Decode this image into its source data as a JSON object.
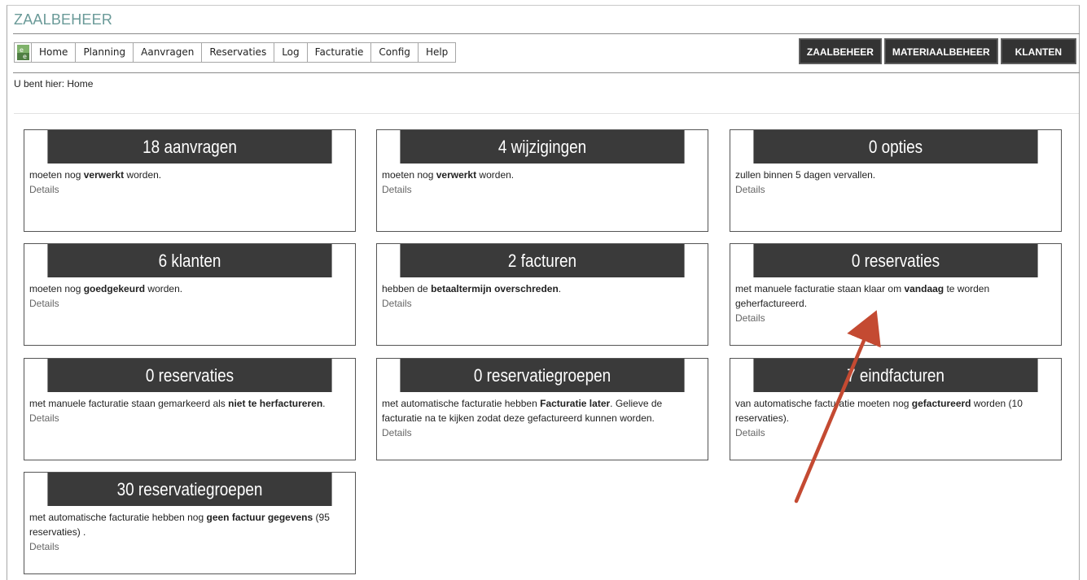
{
  "app": {
    "title": "ZAALBEHEER"
  },
  "menu": {
    "logo_icon": "app-logo-icon",
    "items": [
      "Home",
      "Planning",
      "Aanvragen",
      "Reservaties",
      "Log",
      "Facturatie",
      "Config",
      "Help"
    ]
  },
  "top_buttons": [
    "ZAALBEHEER",
    "MATERIAALBEHEER",
    "KLANTEN"
  ],
  "breadcrumb": "U bent hier: Home",
  "cards": [
    {
      "title": "18 aanvragen",
      "body": [
        {
          "t": "moeten nog "
        },
        {
          "b": "verwerkt"
        },
        {
          "t": " worden."
        }
      ],
      "details": "Details"
    },
    {
      "title": "4 wijzigingen",
      "body": [
        {
          "t": "moeten nog "
        },
        {
          "b": "verwerkt"
        },
        {
          "t": " worden."
        }
      ],
      "details": "Details"
    },
    {
      "title": "0 opties",
      "body": [
        {
          "t": "zullen binnen 5 dagen vervallen."
        }
      ],
      "details": "Details"
    },
    {
      "title": "6 klanten",
      "body": [
        {
          "t": "moeten nog "
        },
        {
          "b": "goedgekeurd"
        },
        {
          "t": " worden."
        }
      ],
      "details": "Details"
    },
    {
      "title": "2 facturen",
      "body": [
        {
          "t": "hebben de "
        },
        {
          "b": "betaaltermijn overschreden"
        },
        {
          "t": "."
        }
      ],
      "details": "Details"
    },
    {
      "title": "0 reservaties",
      "body": [
        {
          "t": "met manuele facturatie staan klaar om "
        },
        {
          "b": "vandaag"
        },
        {
          "t": " te worden geherfactureerd."
        }
      ],
      "details": "Details"
    },
    {
      "title": "0 reservaties",
      "body": [
        {
          "t": "met manuele facturatie staan gemarkeerd als "
        },
        {
          "b": "niet te herfactureren"
        },
        {
          "t": "."
        }
      ],
      "details": "Details"
    },
    {
      "title": "0 reservatiegroepen",
      "body": [
        {
          "t": "met automatische facturatie hebben "
        },
        {
          "b": "Facturatie later"
        },
        {
          "t": ". Gelieve de facturatie na te kijken zodat deze gefactureerd kunnen worden."
        }
      ],
      "details": "Details"
    },
    {
      "title": "7 eindfacturen",
      "body": [
        {
          "t": "van automatische facturatie moeten nog "
        },
        {
          "b": "gefactureerd"
        },
        {
          "t": " worden (10 reservaties)."
        }
      ],
      "details": "Details"
    },
    {
      "title": "30 reservatiegroepen",
      "body": [
        {
          "t": "met automatische facturatie hebben nog "
        },
        {
          "b": "geen factuur gegevens"
        },
        {
          "t": " (95 reservaties) ."
        }
      ],
      "details": "Details"
    }
  ],
  "annotation": {
    "icon": "arrow-annotation-icon",
    "color": "#c0392b"
  }
}
